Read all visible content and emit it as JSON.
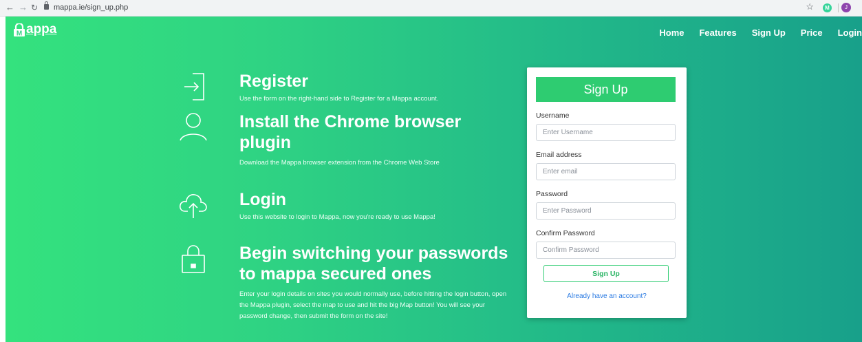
{
  "browser": {
    "url": "mappa.ie/sign_up.php",
    "extension_letter": "M",
    "profile_letter": "J"
  },
  "brand": {
    "name": "appa"
  },
  "nav": {
    "items": [
      "Home",
      "Features",
      "Sign Up",
      "Price",
      "Login"
    ]
  },
  "steps": [
    {
      "icon": "enter-icon",
      "title": "Register",
      "description": "Use the form on the right-hand side to Register for a Mappa account."
    },
    {
      "icon": "user-icon",
      "title": "Install the Chrome browser plugin",
      "description": "Download the Mappa browser extension from the Chrome Web Store"
    },
    {
      "icon": "cloud-upload-icon",
      "title": "Login",
      "description": "Use this website to login to Mappa, now you're ready to use Mappa!"
    },
    {
      "icon": "padlock-icon",
      "title": "Begin switching your passwords to mappa secured ones",
      "description": "Enter your login details on sites you would normally use, before hitting the login button, open the Mappa plugin, select the map to use and hit the big Map button! You will see your password change, then submit the form on the site!"
    }
  ],
  "form": {
    "heading": "Sign Up",
    "fields": [
      {
        "label": "Username",
        "placeholder": "Enter Username",
        "value": ""
      },
      {
        "label": "Email address",
        "placeholder": "Enter email",
        "value": ""
      },
      {
        "label": "Password",
        "placeholder": "Enter Password",
        "value": ""
      },
      {
        "label": "Confirm Password",
        "placeholder": "Confirm Password",
        "value": ""
      }
    ],
    "submit_label": "Sign Up",
    "account_link": "Already have an account?"
  },
  "colors": {
    "gradient_start": "#34e27e",
    "gradient_end": "#18a08a",
    "accent": "#2ecc71",
    "link": "#2a7ae2"
  }
}
